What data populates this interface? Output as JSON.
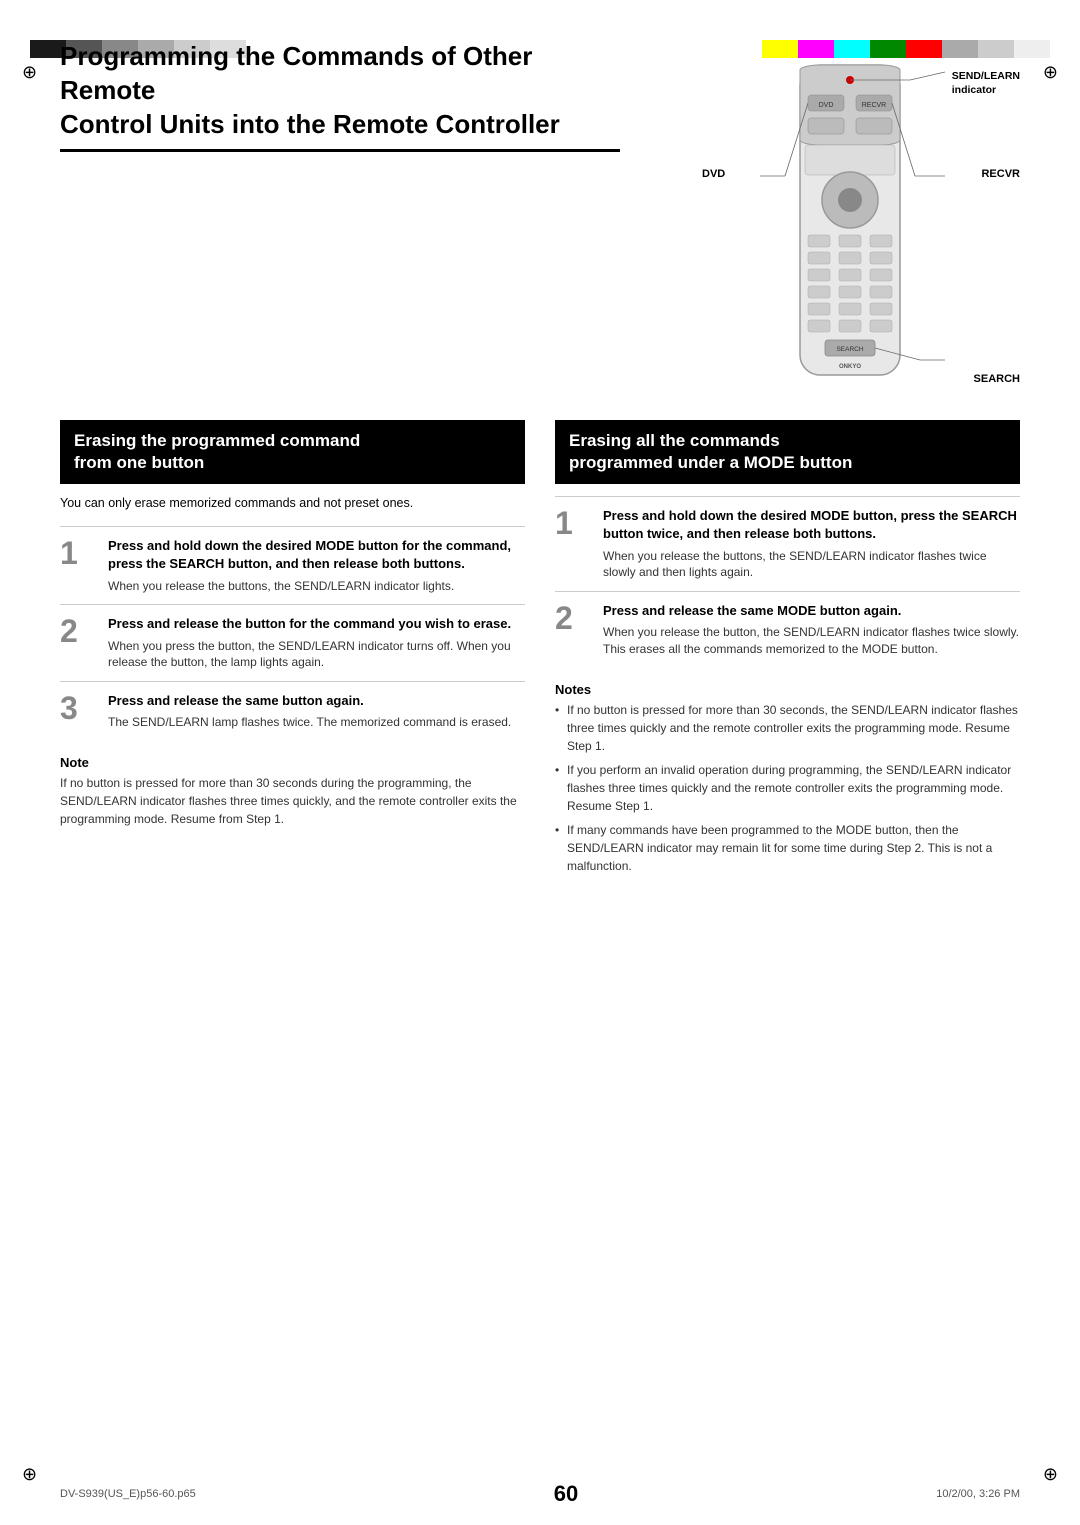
{
  "page": {
    "title_line1": "Programming the Commands of Other Remote",
    "title_line2": "Control Units into the Remote Controller",
    "page_number": "60",
    "footer_left": "DV-S939(US_E)p56-60.p65",
    "footer_center": "60",
    "footer_right": "10/2/00, 3:26 PM"
  },
  "colors": {
    "top_left": [
      "#1a1a1a",
      "#555555",
      "#888888",
      "#aaaaaa",
      "#cccccc",
      "#dddddd"
    ],
    "top_right": [
      "#ffff00",
      "#ff00ff",
      "#00ffff",
      "#00aa00",
      "#ff0000",
      "#aaaaaa",
      "#cccccc",
      "#eeeeee"
    ]
  },
  "remote": {
    "label_send_learn": "SEND/LEARN\nindicator",
    "label_dvd": "DVD",
    "label_recvr": "RECVR",
    "label_search": "SEARCH"
  },
  "left_section": {
    "header": "Erasing the programmed command\nfrom one button",
    "subtitle": "You can only erase memorized commands and not preset ones.",
    "steps": [
      {
        "number": "1",
        "title": "Press and hold down the desired MODE button for the command, press the SEARCH button, and then release both buttons.",
        "desc": "When you release the buttons, the SEND/LEARN indicator lights."
      },
      {
        "number": "2",
        "title": "Press and release the button for the command you wish to erase.",
        "desc": "When you press the button, the SEND/LEARN indicator turns off. When you release the button, the lamp lights again."
      },
      {
        "number": "3",
        "title": "Press and release the same button again.",
        "desc": "The SEND/LEARN lamp flashes twice. The memorized command is erased."
      }
    ],
    "note_title": "Note",
    "note_text": "If no button is pressed for more than 30 seconds during the programming, the SEND/LEARN indicator flashes three times quickly, and the remote controller exits the programming mode. Resume from Step 1."
  },
  "right_section": {
    "header": "Erasing all the commands\nprogrammed under a MODE button",
    "steps": [
      {
        "number": "1",
        "title": "Press and hold down the desired MODE button, press the SEARCH button twice, and then release both buttons.",
        "desc": "When you release the buttons, the SEND/LEARN indicator flashes twice slowly and then lights again."
      },
      {
        "number": "2",
        "title": "Press and release the same MODE button again.",
        "desc": "When you release the button, the SEND/LEARN indicator flashes twice slowly. This erases all the commands memorized to the MODE button."
      }
    ],
    "notes_title": "Notes",
    "notes": [
      "If no button is pressed for more than 30 seconds, the SEND/LEARN indicator flashes three times quickly and the remote controller exits the programming mode. Resume Step 1.",
      "If you perform an invalid operation during programming, the SEND/LEARN indicator flashes three times quickly and the remote controller exits the programming mode. Resume Step 1.",
      "If many commands have been programmed to the MODE button, then the SEND/LEARN indicator may remain lit for some time during Step 2. This is not a malfunction."
    ]
  }
}
